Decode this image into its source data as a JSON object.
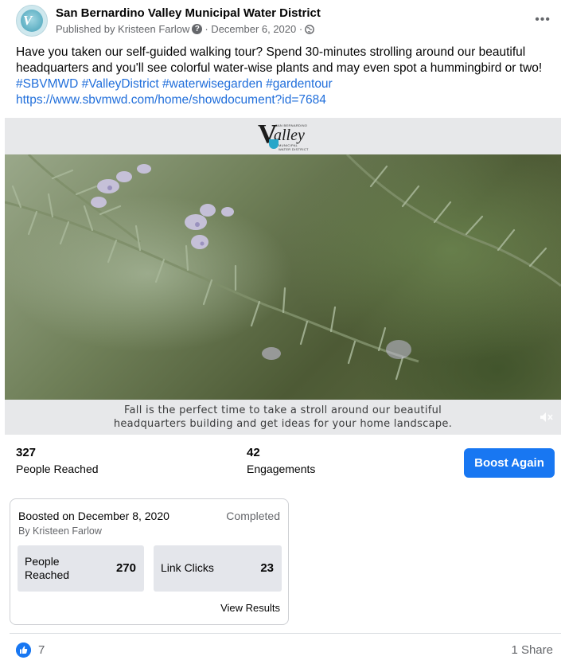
{
  "header": {
    "page_name": "San Bernardino Valley Municipal Water District",
    "published_prefix": "Published by Kristeen Farlow",
    "date": "· December 6, 2020 ·",
    "more_icon": "ellipsis-icon",
    "avatar_letter": "V"
  },
  "post": {
    "text": "Have you taken our self-guided walking tour? Spend 30-minutes strolling around our beautiful headquarters and you'll see colorful water-wise plants and may even spot a hummingbird or two! ",
    "hashtags": "#SBVMWD #ValleyDistrict #waterwisegarden #gardentour",
    "link": "https://www.sbvmwd.com/home/showdocument?id=7684"
  },
  "media": {
    "logo_small_top": "SAN BERNARDINO",
    "logo_word": "alley",
    "logo_big": "V",
    "logo_sub1": "MUNICIPAL",
    "logo_sub2": "WATER DISTRICT",
    "caption_line1": "Fall is the perfect time to take a stroll around our beautiful",
    "caption_line2": "headquarters building and get ideas for your home landscape.",
    "mute_icon": "speaker-muted-icon"
  },
  "stats": {
    "reached_value": "327",
    "reached_label": "People Reached",
    "engagements_value": "42",
    "engagements_label": "Engagements",
    "boost_button": "Boost Again"
  },
  "boost_card": {
    "boosted_on": "Boosted on December 8, 2020",
    "status": "Completed",
    "by": "By Kristeen Farlow",
    "metric1_label_line1": "People",
    "metric1_label_line2": "Reached",
    "metric1_value": "270",
    "metric2_label": "Link Clicks",
    "metric2_value": "23",
    "view_results": "View Results"
  },
  "footer": {
    "likes": "7",
    "shares": "1 Share",
    "like_icon": "thumbs-up-icon"
  },
  "colors": {
    "accent": "#1877f2",
    "link": "#216fdb",
    "muted_text": "#65676b"
  }
}
